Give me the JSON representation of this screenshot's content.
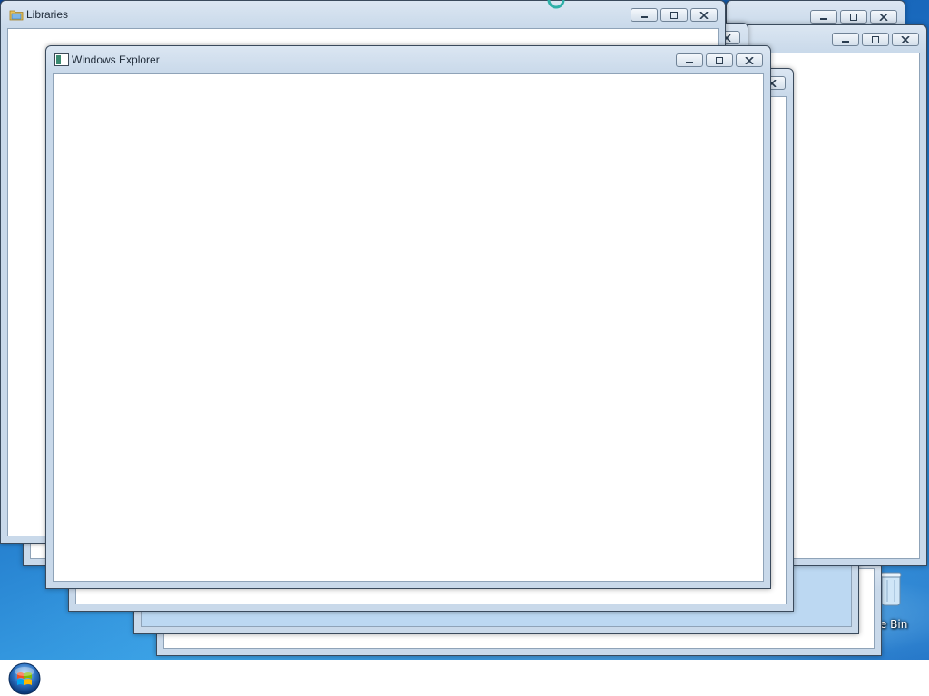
{
  "desktop": {
    "icons": [
      {
        "label": "cle Bin",
        "icon": "recycle-bin-icon"
      }
    ]
  },
  "windows": {
    "libraries": {
      "title": "Libraries",
      "icon": "library-folder-icon"
    },
    "explorer": {
      "title": "Windows Explorer",
      "icon": "explorer-window-icon"
    }
  },
  "controls": {
    "minimize": "minimize-icon",
    "maximize": "maximize-icon",
    "close": "close-icon"
  },
  "taskbar": {
    "start_icon": "windows-start-orb-icon"
  },
  "colors": {
    "desktop": "#1e73c6",
    "frame": "#c9d9ea",
    "client": "#ffffff",
    "taskbar": "#ffffff"
  }
}
